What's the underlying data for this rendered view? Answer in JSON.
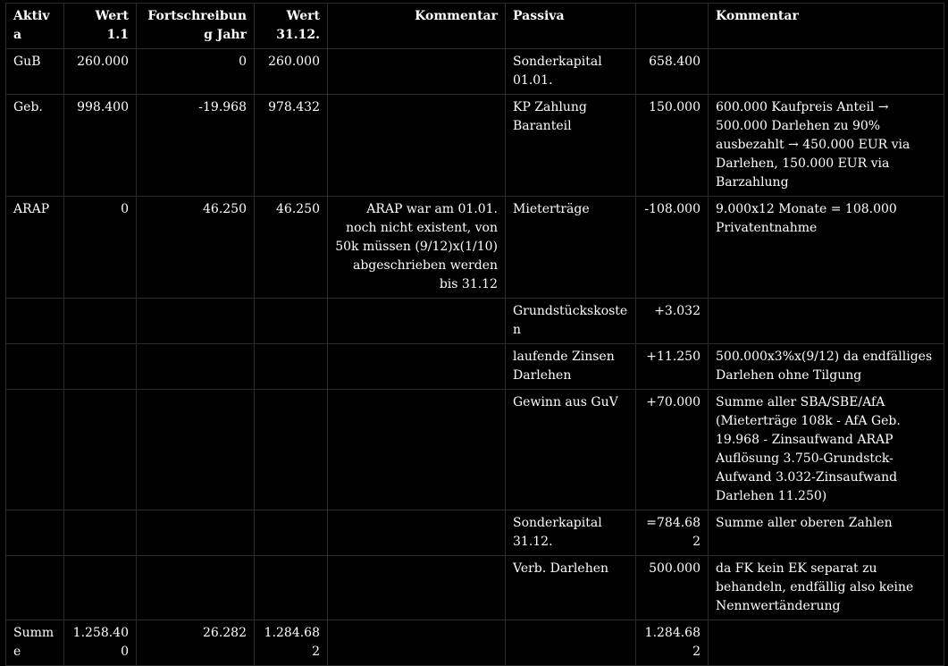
{
  "headers": {
    "aktiva": "Aktiva",
    "wert11": "Wert 1.1",
    "fortschreibung": "Fortschreibung Jahr",
    "wert3112": "Wert 31.12.",
    "kommentar_a": "Kommentar",
    "passiva": "Passiva",
    "passiva_wert": "",
    "kommentar_p": "Kommentar"
  },
  "rows": [
    {
      "aktiva": "GuB",
      "wert11": "260.000",
      "fortschreibung": "0",
      "wert3112": "260.000",
      "kommentar_a": "",
      "passiva": "Sonderkapital 01.01.",
      "passiva_wert": "658.400",
      "kommentar_p": ""
    },
    {
      "aktiva": "Geb.",
      "wert11": "998.400",
      "fortschreibung": "-19.968",
      "wert3112": "978.432",
      "kommentar_a": "",
      "passiva": "KP Zahlung Baranteil",
      "passiva_wert": "150.000",
      "kommentar_p": "600.000 Kaufpreis Anteil → 500.000 Darlehen zu 90% ausbezahlt → 450.000 EUR via Darlehen, 150.000 EUR via Barzahlung"
    },
    {
      "aktiva": "ARAP",
      "wert11": "0",
      "fortschreibung": "46.250",
      "wert3112": "46.250",
      "kommentar_a": "ARAP war am 01.01. noch nicht existent, von 50k müssen (9/12)x(1/10) abgeschrieben werden bis 31.12",
      "passiva": "Mieterträge",
      "passiva_wert": "-108.000",
      "kommentar_p": "9.000x12 Monate = 108.000 Privatentnahme"
    },
    {
      "aktiva": "",
      "wert11": "",
      "fortschreibung": "",
      "wert3112": "",
      "kommentar_a": "",
      "passiva": "Grundstückskosten",
      "passiva_wert": "+3.032",
      "kommentar_p": ""
    },
    {
      "aktiva": "",
      "wert11": "",
      "fortschreibung": "",
      "wert3112": "",
      "kommentar_a": "",
      "passiva": "laufende Zinsen Darlehen",
      "passiva_wert": "+11.250",
      "kommentar_p": "500.000x3%x(9/12) da endfälliges Darlehen ohne Tilgung"
    },
    {
      "aktiva": "",
      "wert11": "",
      "fortschreibung": "",
      "wert3112": "",
      "kommentar_a": "",
      "passiva": "Gewinn aus GuV",
      "passiva_wert": "+70.000",
      "kommentar_p": "Summe aller SBA/SBE/AfA (Mieterträge 108k - AfA Geb. 19.968 - Zinsaufwand ARAP Auflösung 3.750-Grundstck-Aufwand 3.032-Zinsaufwand Darlehen 11.250)"
    },
    {
      "aktiva": "",
      "wert11": "",
      "fortschreibung": "",
      "wert3112": "",
      "kommentar_a": "",
      "passiva": "Sonderkapital 31.12.",
      "passiva_wert": "=784.682",
      "kommentar_p": "Summe aller oberen Zahlen"
    },
    {
      "aktiva": "",
      "wert11": "",
      "fortschreibung": "",
      "wert3112": "",
      "kommentar_a": "",
      "passiva": "Verb. Darlehen",
      "passiva_wert": "500.000",
      "kommentar_p": "da FK kein EK separat zu behandeln, endfällig also keine Nennwertänderung"
    },
    {
      "aktiva": "Summe",
      "wert11": "1.258.400",
      "fortschreibung": "26.282",
      "wert3112": "1.284.682",
      "kommentar_a": "",
      "passiva": "",
      "passiva_wert": "1.284.682",
      "kommentar_p": ""
    }
  ],
  "colors": {
    "background": "#000000",
    "text": "#ffffff",
    "grid": "#2b2b2b"
  }
}
